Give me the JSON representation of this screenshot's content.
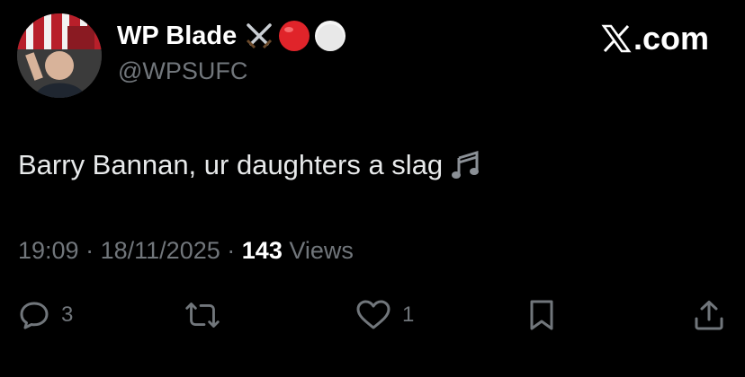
{
  "author": {
    "display_name": "WP Blade",
    "name_emojis": [
      "crossed-swords-icon",
      "red-circle-icon",
      "white-circle-icon"
    ],
    "handle": "@WPSUFC"
  },
  "brand": {
    "label": ".com",
    "icon": "x-logo-icon"
  },
  "tweet": {
    "text": "Barry Bannan, ur daughters a slag",
    "emoji": "musical-notes-icon"
  },
  "meta": {
    "time": "19:09",
    "sep1": "·",
    "date": "18/11/2025",
    "sep2": "·",
    "views_count": "143",
    "views_label": "Views"
  },
  "actions": {
    "reply_count": "3",
    "retweet_count": "",
    "like_count": "1"
  },
  "colors": {
    "background": "#000000",
    "text": "#e7e9ea",
    "muted": "#71767b",
    "red": "#e0242a",
    "white": "#ffffff"
  }
}
